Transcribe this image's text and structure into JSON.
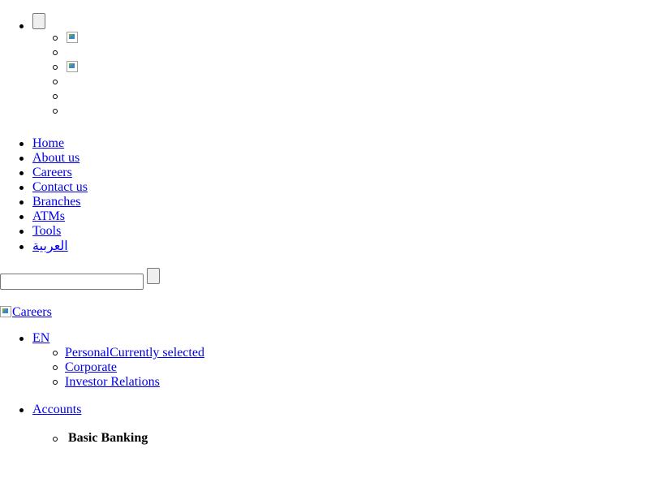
{
  "top_menu": {
    "sub_items": [
      {
        "type": "image",
        "icon": "broken-image-icon"
      },
      {
        "type": "empty"
      },
      {
        "type": "image",
        "icon": "broken-image-icon"
      },
      {
        "type": "empty"
      },
      {
        "type": "empty"
      },
      {
        "type": "empty"
      }
    ]
  },
  "main_nav": {
    "items": [
      {
        "label": "Home"
      },
      {
        "label": "About us"
      },
      {
        "label": "Careers"
      },
      {
        "label": "Contact us"
      },
      {
        "label": "Branches"
      },
      {
        "label": "ATMs"
      },
      {
        "label": "Tools"
      },
      {
        "label": "العربية"
      }
    ]
  },
  "search": {
    "value": "",
    "placeholder": ""
  },
  "logo": {
    "alt_text": "Careers",
    "icon": "broken-image-icon"
  },
  "segments": {
    "language_label": "EN",
    "items": [
      {
        "label": "Personal",
        "status": "Currently selected"
      },
      {
        "label": "Corporate",
        "status": ""
      },
      {
        "label": "Investor Relations",
        "status": ""
      }
    ]
  },
  "accounts": {
    "label": "Accounts",
    "sub_items": [
      {
        "label": "Basic Banking"
      }
    ]
  },
  "colors": {
    "link": "#0000ee",
    "text": "#000000",
    "background": "#ffffff"
  }
}
